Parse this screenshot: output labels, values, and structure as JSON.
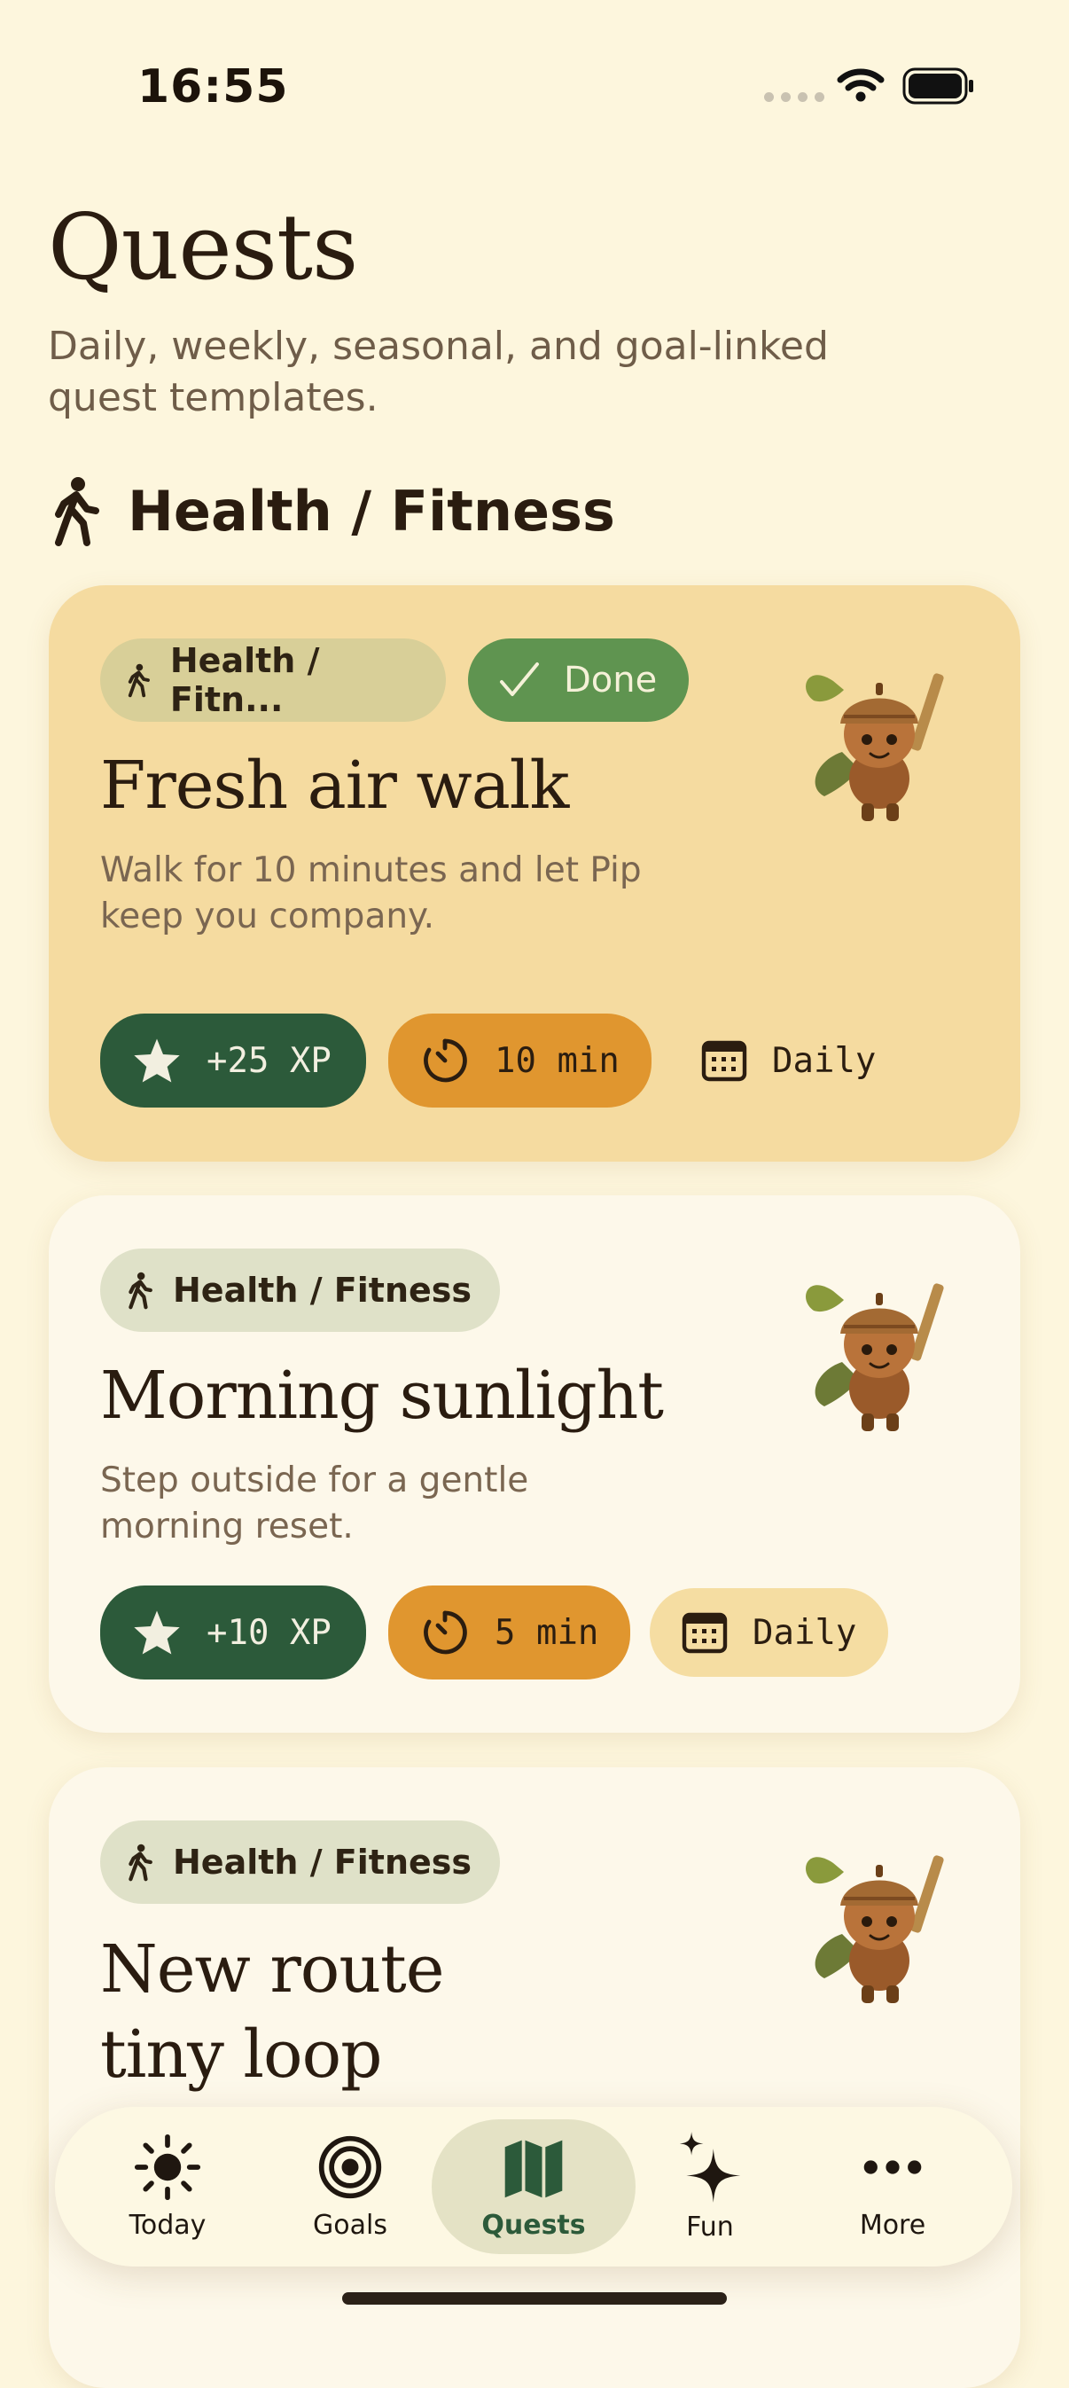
{
  "status_bar": {
    "time": "16:55"
  },
  "header": {
    "title": "Quests",
    "subtitle": "Daily, weekly, seasonal, and goal-linked quest templates."
  },
  "section": {
    "title": "Health / Fitness",
    "icon": "walking-person-icon"
  },
  "quests": [
    {
      "category": "Health / Fitn...",
      "status": "Done",
      "title": "Fresh air walk",
      "description": "Walk for 10 minutes and let Pip keep you company.",
      "xp": "+25 XP",
      "duration": "10 min",
      "frequency": "Daily"
    },
    {
      "category": "Health / Fitness",
      "title": "Morning sunlight",
      "description": "Step outside for a gentle morning reset.",
      "xp": "+10 XP",
      "duration": "5 min",
      "frequency": "Daily"
    },
    {
      "category": "Health / Fitness",
      "title_line1": "New route",
      "title_line2": "tiny loop"
    }
  ],
  "tabbar": {
    "items": [
      {
        "label": "Today",
        "icon": "sun-icon"
      },
      {
        "label": "Goals",
        "icon": "target-icon"
      },
      {
        "label": "Quests",
        "icon": "map-icon",
        "active": true
      },
      {
        "label": "Fun",
        "icon": "sparkles-icon"
      },
      {
        "label": "More",
        "icon": "ellipsis-icon"
      }
    ]
  },
  "colors": {
    "background": "#fdf6dd",
    "done_card": "#f5dba0",
    "accent_green": "#2c5a3a",
    "accent_orange": "#e0962f",
    "done_green": "#5f9450"
  }
}
